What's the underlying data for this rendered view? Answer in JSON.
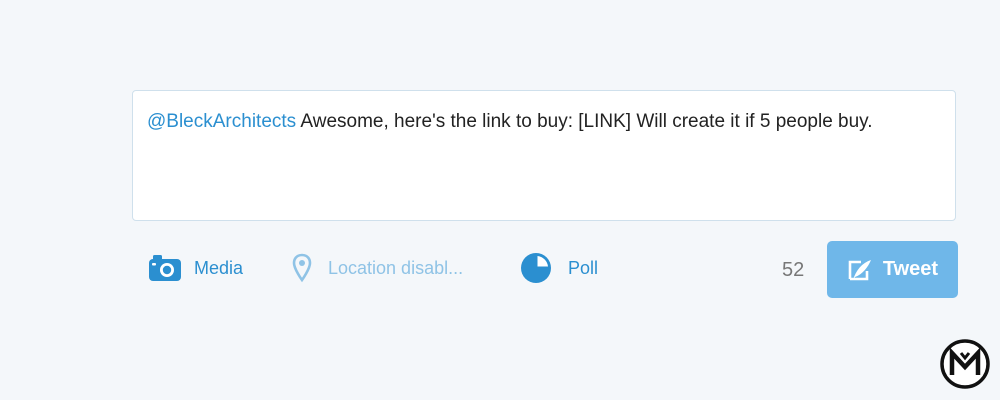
{
  "compose": {
    "mention": "@BleckArchitects",
    "text": " Awesome, here's the link to buy: [LINK] Will create it if 5 people buy."
  },
  "toolbar": {
    "media_label": "Media",
    "media_icon": "camera-icon",
    "location_label": "Location disabl...",
    "location_icon": "location-pin-icon",
    "poll_label": "Poll",
    "poll_icon": "poll-icon"
  },
  "char_count": "52",
  "tweet_button": {
    "label": "Tweet",
    "icon": "compose-feather-icon"
  },
  "colors": {
    "accent": "#2b8fd0",
    "disabled_accent": "#8fc3e6",
    "button_bg": "#6fb7e9",
    "page_bg": "#f4f7fa"
  },
  "logo": {
    "text": "M"
  }
}
